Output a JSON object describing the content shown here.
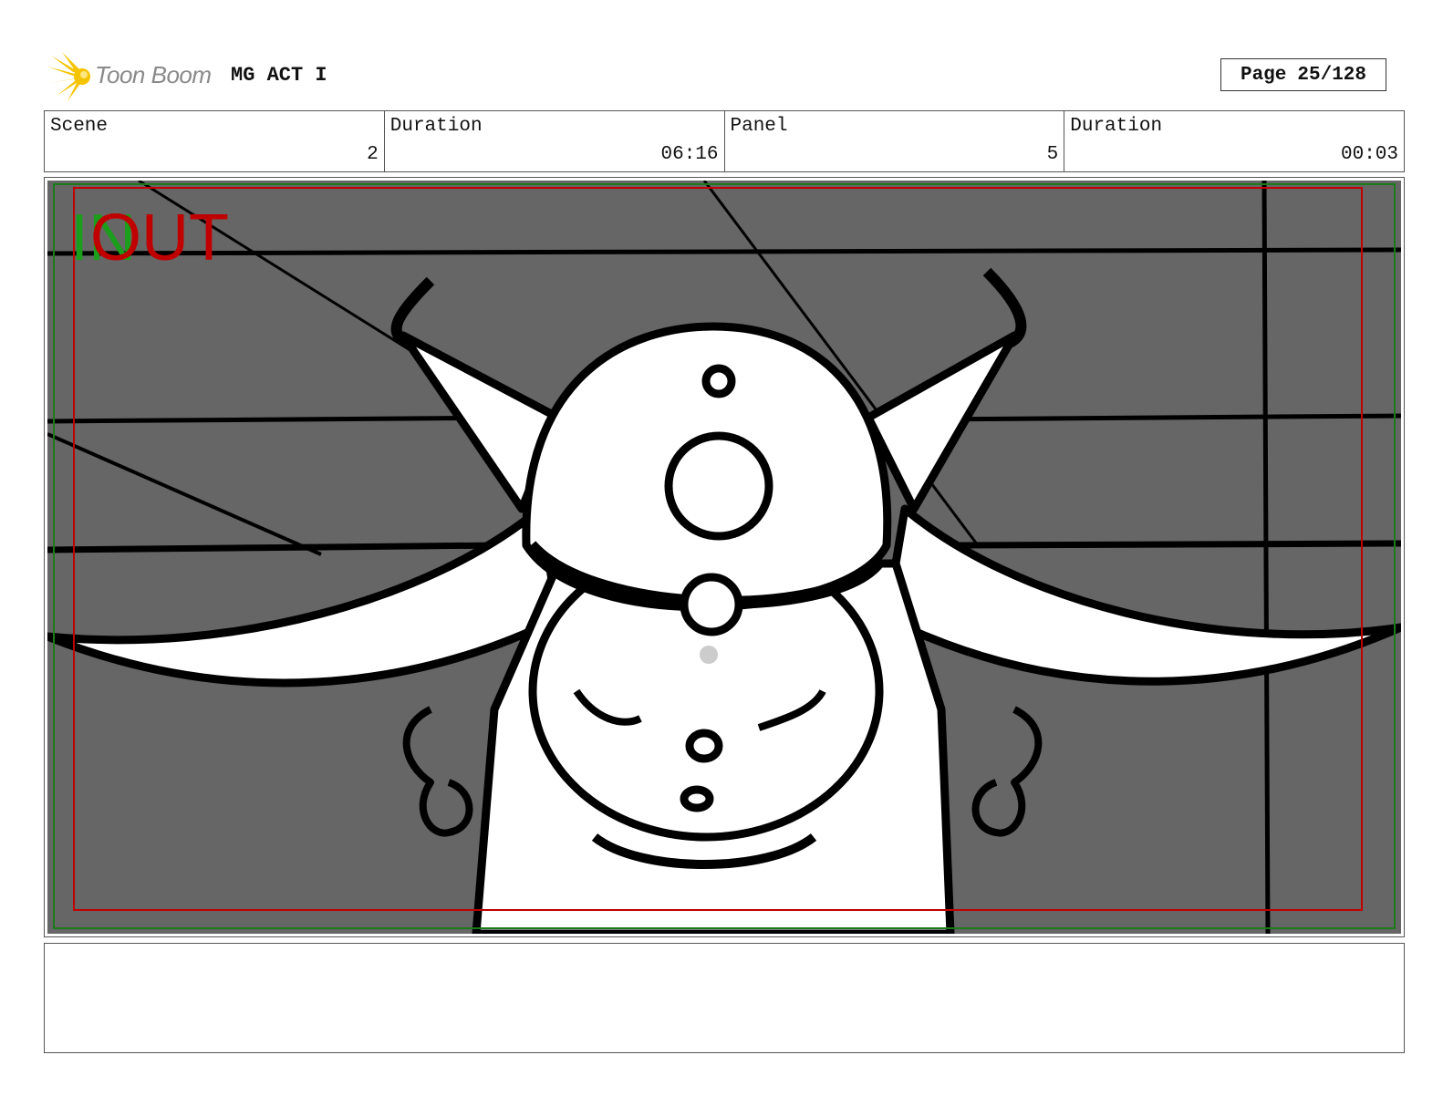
{
  "header": {
    "logo_text": "Toon Boom",
    "project_title": "MG ACT I",
    "page_label": "Page",
    "page_value": "25/128"
  },
  "info": [
    {
      "label": "Scene",
      "value": "2"
    },
    {
      "label": "Duration",
      "value": "06:16"
    },
    {
      "label": "Panel",
      "value": "5"
    },
    {
      "label": "Duration",
      "value": "00:03"
    }
  ],
  "panel": {
    "in_label": "IN",
    "out_label": "OUT",
    "background_color": "#666666",
    "safe_frame_color": "#c00000",
    "field_frame_color": "#1b7a1b"
  },
  "notes": {
    "text": ""
  }
}
